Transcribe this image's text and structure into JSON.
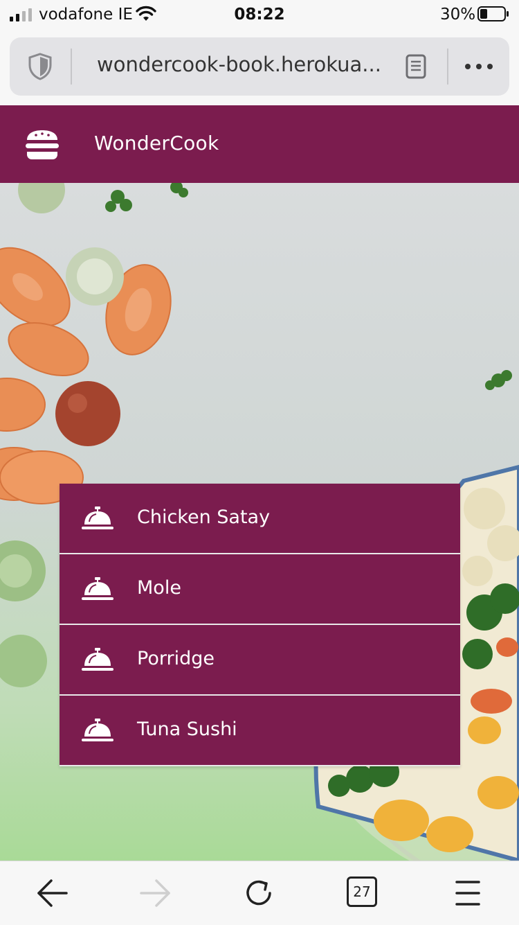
{
  "status_bar": {
    "carrier": "vodafone IE",
    "time": "08:22",
    "battery_percent": "30%"
  },
  "browser": {
    "url": "wondercook-book.herokua...",
    "open_tabs_count": "27"
  },
  "app": {
    "brand": "WonderCook",
    "header_color": "#7b1c4e"
  },
  "recipes": [
    {
      "name": "Chicken Satay"
    },
    {
      "name": "Mole"
    },
    {
      "name": "Porridge"
    },
    {
      "name": "Tuna Sushi"
    }
  ]
}
